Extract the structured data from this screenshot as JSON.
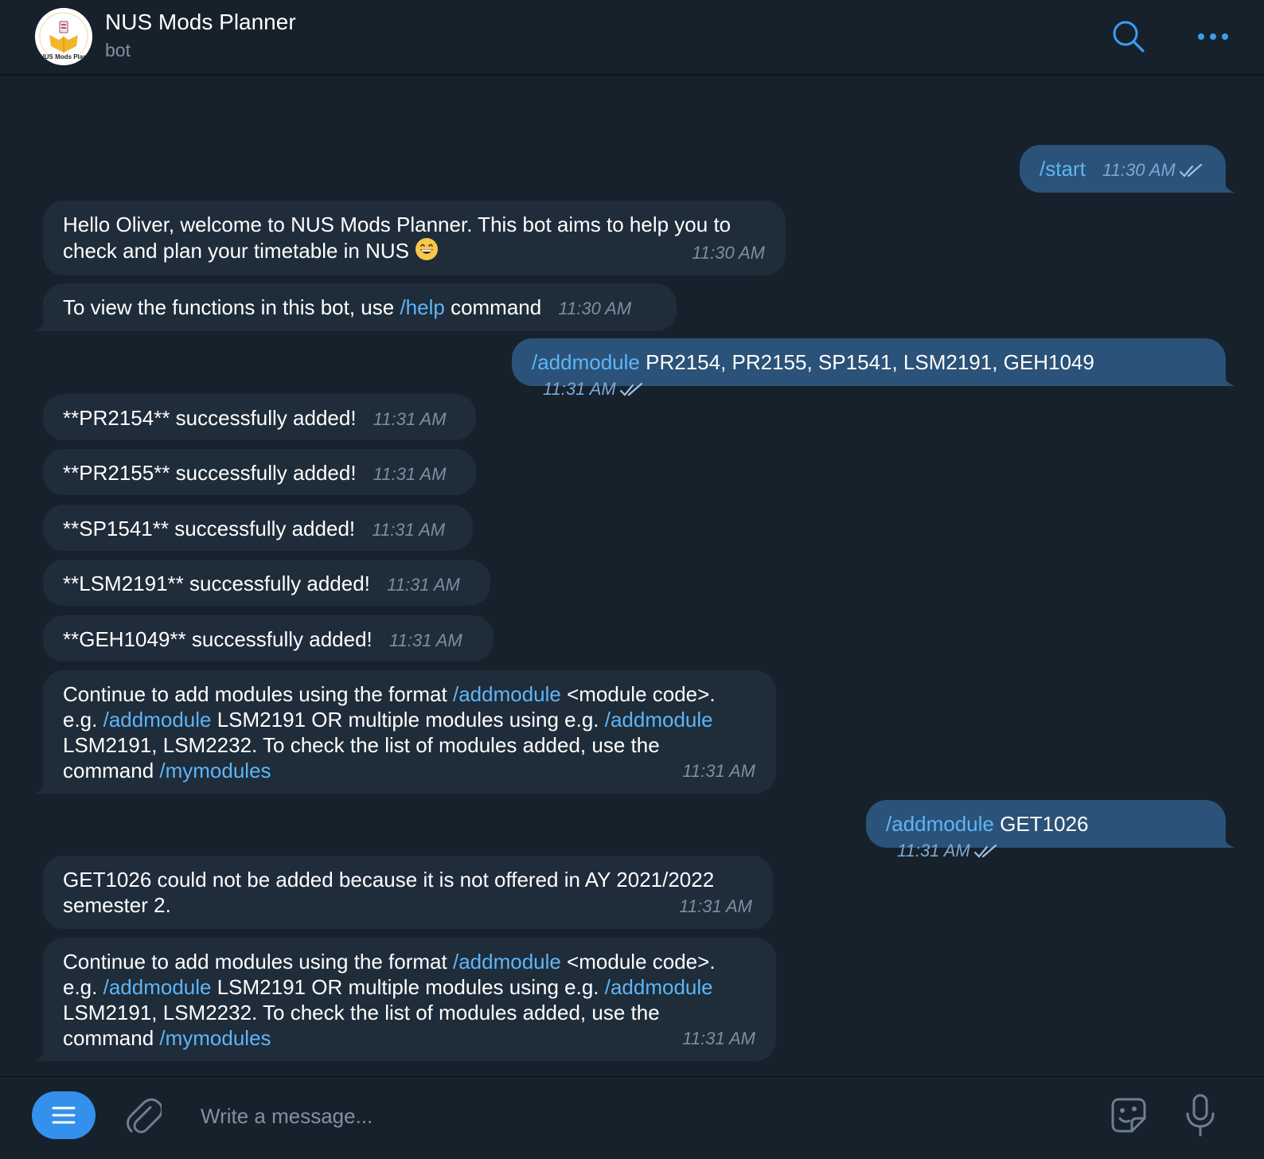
{
  "header": {
    "title": "NUS Mods Planner",
    "subtitle": "bot",
    "avatar_text": "NUS Mods Planner"
  },
  "messages": {
    "m1": {
      "cmd": "/start",
      "time": "11:30 AM"
    },
    "m2": {
      "text": "Hello Oliver, welcome to NUS Mods Planner. This bot aims to help you to check and plan your timetable in NUS",
      "emoji": "grinning-face",
      "time": "11:30 AM"
    },
    "m3": {
      "pre": "To view the functions in this bot, use ",
      "cmd": "/help",
      "post": " command",
      "time": "11:30 AM"
    },
    "m4": {
      "cmd": "/addmodule",
      "post": " PR2154, PR2155, SP1541, LSM2191, GEH1049",
      "time": "11:31 AM"
    },
    "m5": {
      "text": "**PR2154** successfully added!",
      "time": "11:31 AM"
    },
    "m6": {
      "text": "**PR2155** successfully added!",
      "time": "11:31 AM"
    },
    "m7": {
      "text": "**SP1541** successfully added!",
      "time": "11:31 AM"
    },
    "m8": {
      "text": "**LSM2191** successfully added!",
      "time": "11:31 AM"
    },
    "m9": {
      "text": "**GEH1049** successfully added!",
      "time": "11:31 AM"
    },
    "m10": {
      "t1": "Continue to add modules using the format ",
      "c1": "/addmodule",
      "t2": " <module code>.",
      "t3": "e.g. ",
      "c2": "/addmodule",
      "t4": " LSM2191 OR multiple modules using e.g. ",
      "c3": "/addmodule",
      "t5": "LSM2191, LSM2232. To check the list of modules added, use the",
      "t6": "command ",
      "c4": "/mymodules",
      "time": "11:31 AM"
    },
    "m11": {
      "cmd": "/addmodule",
      "post": " GET1026",
      "time": "11:31 AM"
    },
    "m12": {
      "line1": "GET1026 could not be added because it is not offered in AY 2021/2022",
      "line2": "semester 2.",
      "time": "11:31 AM"
    },
    "m13": {
      "t1": "Continue to add modules using the format ",
      "c1": "/addmodule",
      "t2": " <module code>.",
      "t3": "e.g. ",
      "c2": "/addmodule",
      "t4": " LSM2191 OR multiple modules using e.g. ",
      "c3": "/addmodule",
      "t5": "LSM2191, LSM2232. To check the list of modules added, use the",
      "t6": "command ",
      "c4": "/mymodules",
      "time": "11:31 AM"
    }
  },
  "composer": {
    "placeholder": "Write a message..."
  },
  "icons": {
    "search": "search-icon",
    "more": "more-dots-icon",
    "menu": "menu-icon",
    "attach": "paperclip-icon",
    "sticker": "sticker-icon",
    "mic": "microphone-icon",
    "read": "double-check-icon"
  },
  "colors": {
    "accent": "#5eb5f7",
    "outgoing_bubble": "#2b5278",
    "incoming_bubble": "#1f2c3a",
    "background": "#17212b",
    "menu_button": "#3390ec"
  }
}
